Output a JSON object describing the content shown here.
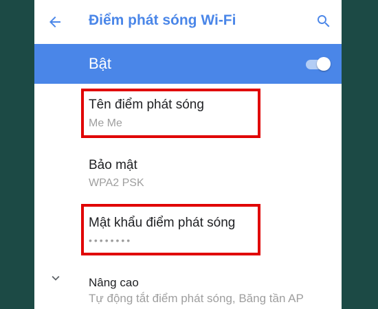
{
  "app_bar": {
    "title": "Điểm phát sóng Wi-Fi",
    "back_icon": "arrow-back-icon",
    "search_icon": "search-icon"
  },
  "hotspot_toggle": {
    "label": "Bật",
    "state": "on"
  },
  "settings": {
    "hotspot_name": {
      "title": "Tên điểm phát sóng",
      "value": "Me Me"
    },
    "security": {
      "title": "Bảo mật",
      "value": "WPA2 PSK"
    },
    "password": {
      "title": "Mật khẩu điểm phát sóng",
      "value": "••••••••"
    },
    "advanced": {
      "title": "Nâng cao",
      "summary": "Tự động tắt điểm phát sóng, Băng tần AP"
    }
  },
  "colors": {
    "accent": "#4a86e8",
    "highlight": "#e00000",
    "background": "#1c4a45"
  }
}
